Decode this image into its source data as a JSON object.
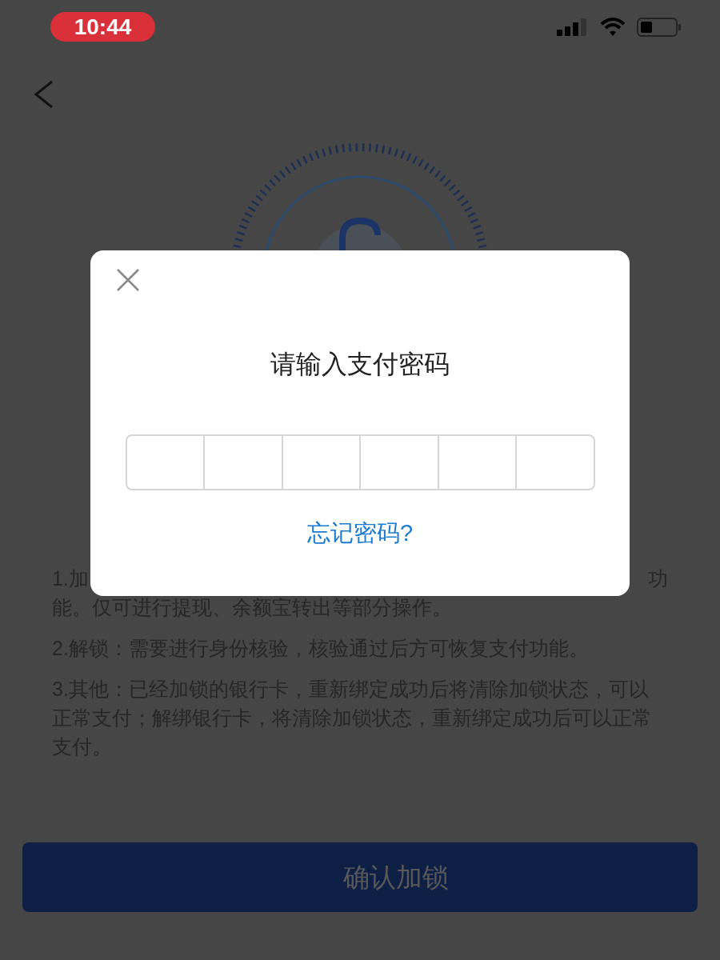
{
  "status_bar": {
    "time": "10:44"
  },
  "password_dialog": {
    "title": "请输入支付密码",
    "digits": [
      {
        "filled": false
      },
      {
        "filled": false
      },
      {
        "filled": false
      },
      {
        "filled": false
      },
      {
        "filled": false
      },
      {
        "filled": false
      }
    ],
    "forgot_link": "忘记密码?"
  },
  "notes": [
    {
      "kind": "cut",
      "left": "1.加",
      "right": "功",
      "next_line": "能。仅可进行提现、余额宝转出等部分操作。"
    },
    {
      "kind": "text",
      "text": "2.解锁：需要进行身份核验，核验通过后方可恢复支付功能。"
    },
    {
      "kind": "text",
      "text": "3.其他：已经加锁的银行卡，重新绑定成功后将清除加锁状态，可以正常支付；解绑银行卡，将清除加锁状态，重新绑定成功后可以正常支付。"
    }
  ],
  "confirm_button": "确认加锁"
}
